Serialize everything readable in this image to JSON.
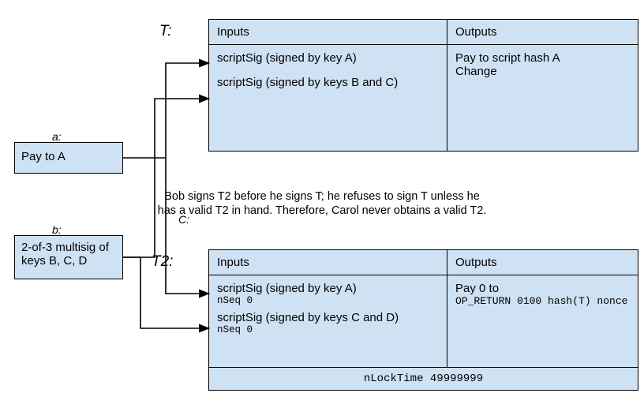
{
  "left": {
    "pay_a_label": "a:",
    "pay_a": "Pay to A",
    "multisig_label": "b:",
    "multisig": "2-of-3 multisig of keys B, C, D"
  },
  "tx_t": {
    "name": "T:",
    "headers": {
      "inputs": "Inputs",
      "outputs": "Outputs"
    },
    "inputs": {
      "line1": "scriptSig (signed by key A)",
      "line2": "scriptSig (signed by keys B and C)"
    },
    "outputs": {
      "line1": "Pay to script hash A",
      "line2": "Change"
    }
  },
  "caption_line1": "Bob signs T2 before he signs T; he refuses to sign T unless he",
  "caption_line2": "has a valid T2 in hand. Therefore, Carol never obtains a valid T2.",
  "tx_t2": {
    "name": "T2:",
    "headers": {
      "inputs": "Inputs",
      "outputs": "Outputs"
    },
    "inputs": {
      "line1": "scriptSig (signed by key A)",
      "nseq1": "nSeq 0",
      "line2": "scriptSig (signed by keys C and D)",
      "nseq2": "nSeq 0"
    },
    "outputs": {
      "line1": "Pay 0 to",
      "opret": "OP_RETURN 0100 hash(T) nonce"
    },
    "footer": "nLockTime 49999999"
  },
  "sees": "C:"
}
